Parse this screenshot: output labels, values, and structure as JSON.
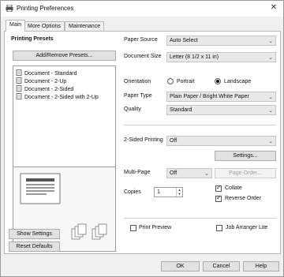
{
  "window": {
    "title": "Printing Preferences",
    "close_glyph": "✕"
  },
  "tabs": [
    {
      "label": "Main",
      "active": true
    },
    {
      "label": "More Options",
      "active": false
    },
    {
      "label": "Maintenance",
      "active": false
    }
  ],
  "presets": {
    "heading": "Printing Presets",
    "add_remove_label": "Add/Remove Presets...",
    "items": [
      "Document - Standard",
      "Document - 2-Up",
      "Document - 2-Sided",
      "Document - 2-Sided with 2-Up"
    ],
    "show_settings_label": "Show Settings",
    "reset_defaults_label": "Reset Defaults"
  },
  "settings": {
    "paper_source": {
      "label": "Paper Source",
      "value": "Auto Select"
    },
    "document_size": {
      "label": "Document Size",
      "value": "Letter (8 1/2 x 11 in)"
    },
    "orientation": {
      "label": "Orientation",
      "portrait": "Portrait",
      "landscape": "Landscape",
      "selected": "Landscape"
    },
    "paper_type": {
      "label": "Paper Type",
      "value": "Plain Paper / Bright White Paper"
    },
    "quality": {
      "label": "Quality",
      "value": "Standard"
    },
    "two_sided": {
      "label": "2-Sided Printing",
      "value": "Off",
      "settings_button": "Settings..."
    },
    "multi_page": {
      "label": "Multi-Page",
      "value": "Off",
      "page_order_button": "Page Order..."
    },
    "copies": {
      "label": "Copies",
      "value": "1"
    },
    "collate": {
      "label": "Collate",
      "checked": true
    },
    "reverse_order": {
      "label": "Reverse Order",
      "checked": true
    },
    "print_preview": {
      "label": "Print Preview",
      "checked": false
    },
    "job_arranger_lite": {
      "label": "Job Arranger Lite",
      "checked": false
    }
  },
  "footer": {
    "ok": "OK",
    "cancel": "Cancel",
    "help": "Help"
  }
}
